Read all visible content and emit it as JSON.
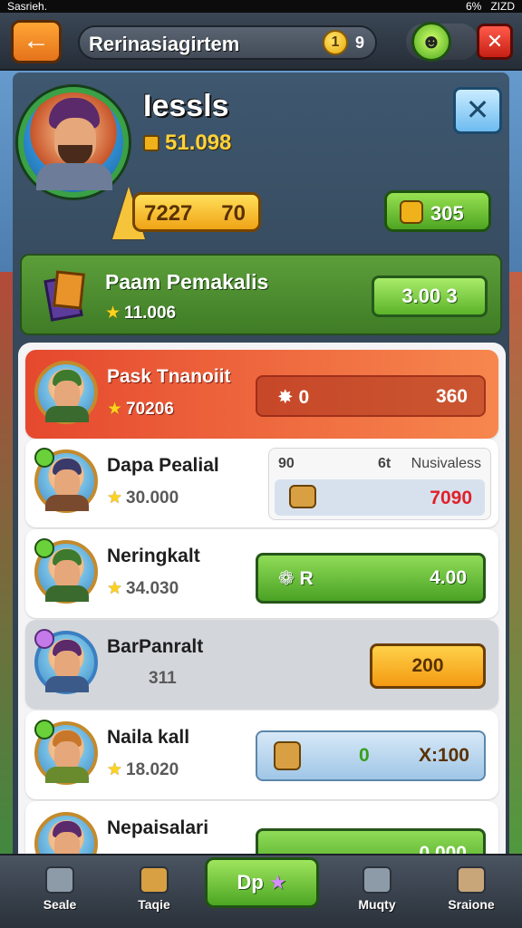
{
  "status_bar": {
    "left": "Sasrieh.",
    "right": "ZIZD",
    "battery": "6%"
  },
  "header": {
    "title": "Rerinasiagirtem",
    "coin_badge": "1",
    "coin_count": "9"
  },
  "profile": {
    "name": "Iessls",
    "gold": "51.098",
    "rank_a": "7227",
    "rank_b": "70",
    "chip_value": "305"
  },
  "featured": {
    "name": "Paam Pemakalis",
    "score": "11.006",
    "button_value": "3.00 3"
  },
  "rows": [
    {
      "name": "Pask Tnanoiit",
      "score": "70206",
      "left": "0",
      "right": "360"
    },
    {
      "name": "Dapa Pealial",
      "score": "30.000",
      "t1": "90",
      "t2": "6t",
      "t3": "Nusivaless",
      "value": "7090"
    },
    {
      "name": "Neringkalt",
      "score": "34.030",
      "left": "R",
      "right": "4.00"
    },
    {
      "name": "BarPanralt",
      "score": "311",
      "value": "200"
    },
    {
      "name": "Naila kall",
      "score": "18.020",
      "left": "0",
      "right": "X:100"
    },
    {
      "name": "Nepaisalari",
      "score": "",
      "right": "0.000"
    }
  ],
  "nav": {
    "items": [
      "Seale",
      "Taqie",
      "Dp",
      "Muqty",
      "Sraione"
    ]
  },
  "colors": {
    "accent_green": "#4ea521",
    "accent_orange": "#f39a12",
    "highlight_row": "#e5482e"
  }
}
